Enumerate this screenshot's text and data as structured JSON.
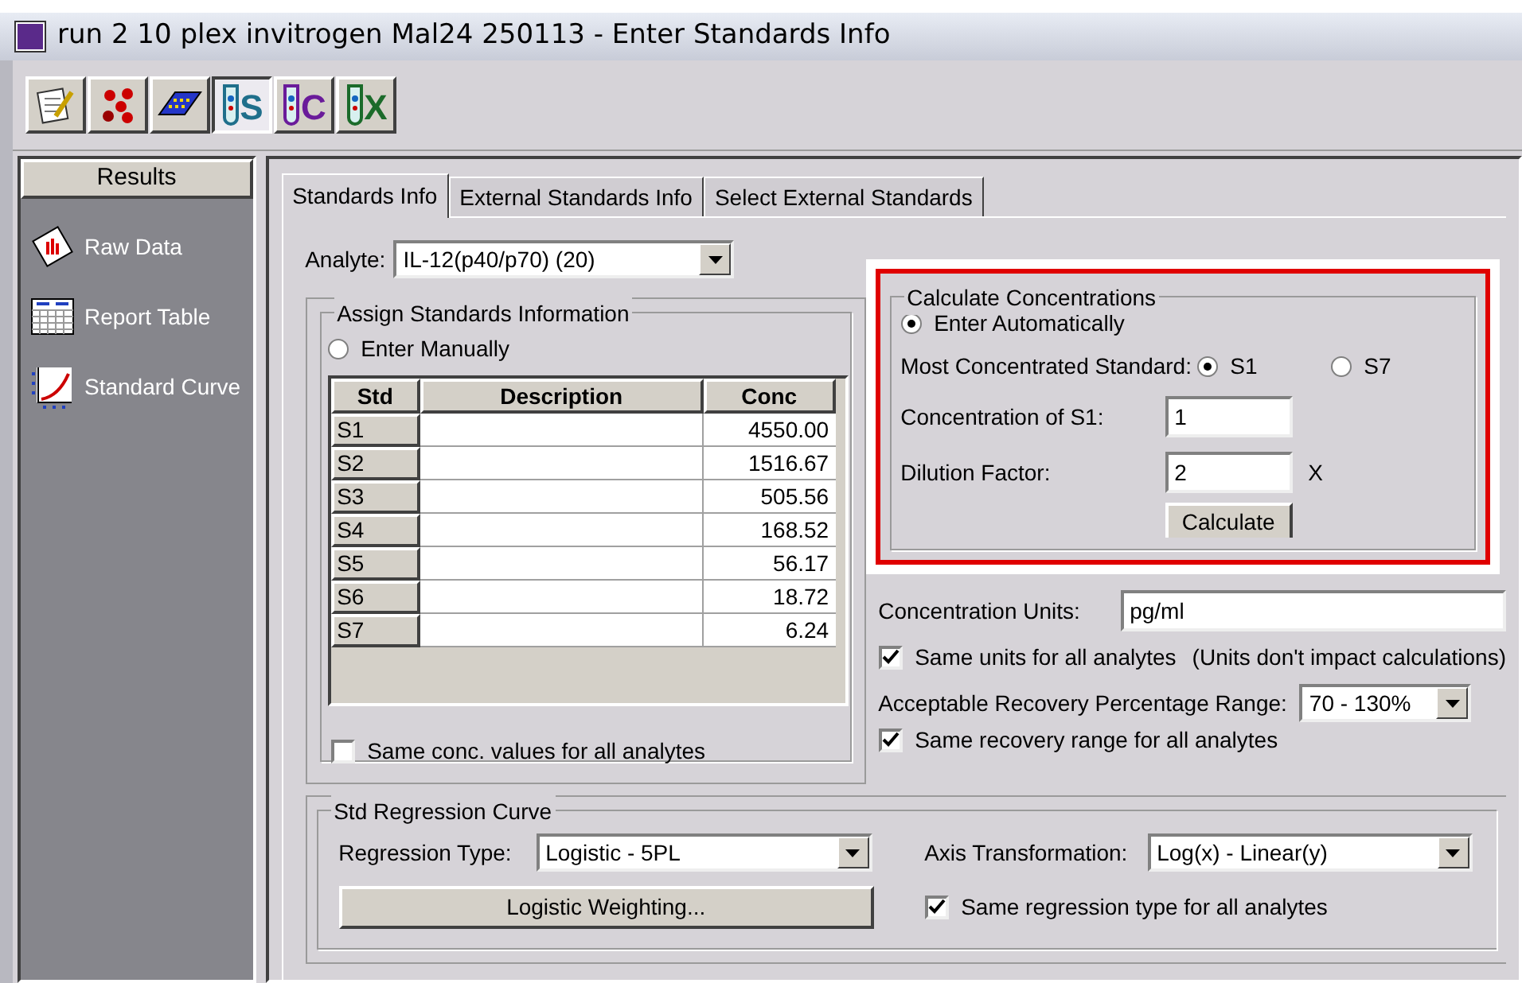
{
  "window": {
    "title": "run 2 10 plex invitrogen Mal24 250113 - Enter Standards Info"
  },
  "toolbar": [
    {
      "kind": "notepad",
      "selected": false
    },
    {
      "kind": "dots",
      "selected": false
    },
    {
      "kind": "plate",
      "selected": false
    },
    {
      "kind": "tube",
      "letter": "S",
      "color": "#1f6f8b",
      "selected": true
    },
    {
      "kind": "tube",
      "letter": "C",
      "color": "#6a1b9a",
      "selected": false
    },
    {
      "kind": "tube",
      "letter": "X",
      "color": "#1b6b2a",
      "selected": false
    }
  ],
  "sidebar": {
    "title": "Results",
    "items": [
      {
        "kind": "raw",
        "label": "Raw Data"
      },
      {
        "kind": "table",
        "label": "Report Table"
      },
      {
        "kind": "curve",
        "label": "Standard Curve"
      }
    ]
  },
  "tabs": [
    {
      "label": "Standards Info",
      "selected": true
    },
    {
      "label": "External Standards Info",
      "selected": false
    },
    {
      "label": "Select External Standards",
      "selected": false
    }
  ],
  "analyte": {
    "label": "Analyte:",
    "value": "IL-12(p40/p70) (20)"
  },
  "assign": {
    "title": "Assign Standards Information",
    "manual": {
      "label": "Enter Manually",
      "selected": false
    },
    "columns": [
      "Std",
      "Description",
      "Conc"
    ],
    "rows": [
      {
        "std": "S1",
        "conc": "4550.00"
      },
      {
        "std": "S2",
        "conc": "1516.67"
      },
      {
        "std": "S3",
        "conc": "505.56"
      },
      {
        "std": "S4",
        "conc": "168.52"
      },
      {
        "std": "S5",
        "conc": "56.17"
      },
      {
        "std": "S6",
        "conc": "18.72"
      },
      {
        "std": "S7",
        "conc": "6.24"
      }
    ],
    "same_conc": {
      "label": "Same conc. values for all analytes",
      "checked": false
    }
  },
  "calculate": {
    "title": "Calculate Concentrations",
    "highlighted": true,
    "auto": {
      "label": "Enter Automatically",
      "selected": true
    },
    "most_label": "Most Concentrated Standard:",
    "most_options": [
      {
        "label": "S1",
        "selected": true
      },
      {
        "label": "S7",
        "selected": false
      }
    ],
    "conc_label": "Concentration of S1:",
    "conc_value": "1",
    "dilution_label": "Dilution Factor:",
    "dilution_value": "2",
    "dilution_unit": "X",
    "button": "Calculate"
  },
  "units": {
    "label": "Concentration Units:",
    "value": "pg/ml",
    "same": {
      "label": "Same units for all analytes",
      "checked": true
    },
    "note": "(Units don't impact calculations)"
  },
  "recovery": {
    "label": "Acceptable Recovery Percentage Range:",
    "value": "70 - 130%",
    "same": {
      "label": "Same recovery range for all analytes",
      "checked": true
    }
  },
  "regression": {
    "title": "Std Regression Curve",
    "type_label": "Regression Type:",
    "type_value": "Logistic - 5PL",
    "axis_label": "Axis Transformation:",
    "axis_value": "Log(x) - Linear(y)",
    "weighting": "Logistic Weighting...",
    "same": {
      "label": "Same regression type for all analytes",
      "checked": true
    }
  }
}
